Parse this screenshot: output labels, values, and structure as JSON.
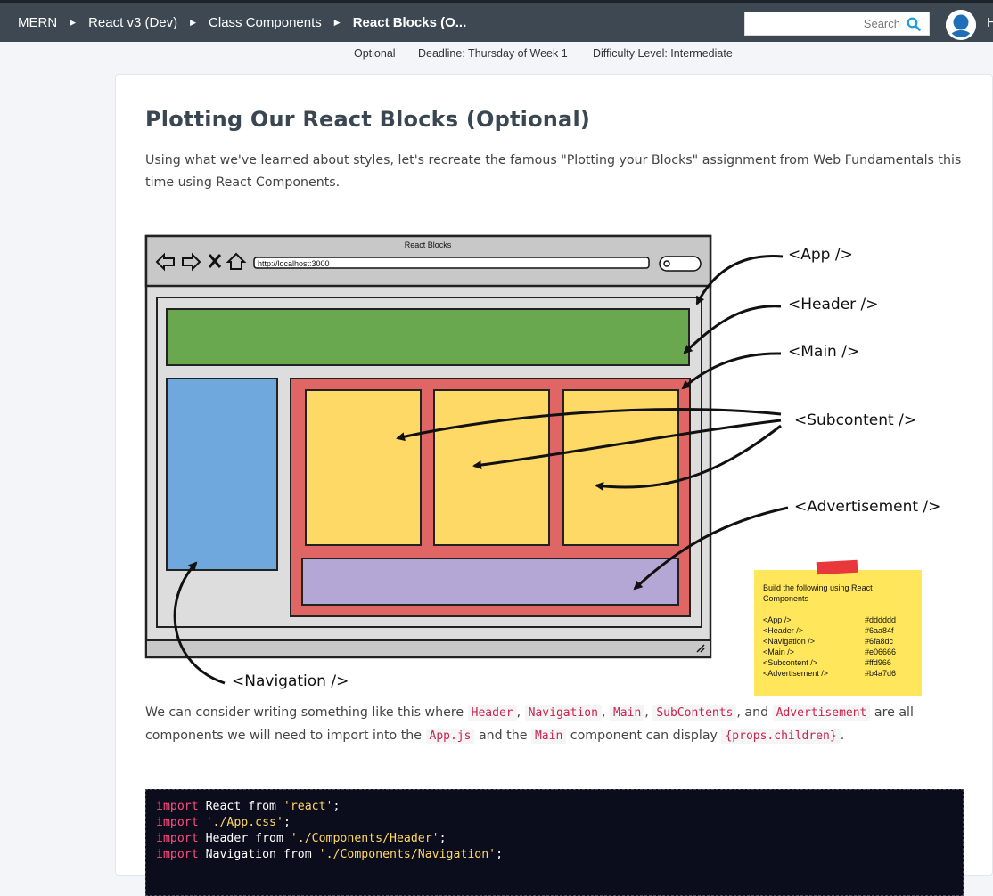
{
  "breadcrumb": [
    "MERN",
    "React v3 (Dev)",
    "Class Components",
    "React Blocks (O..."
  ],
  "search": {
    "placeholder": "Search"
  },
  "user_initial": "H",
  "meta": {
    "optional": "Optional",
    "deadline": "Deadline: Thursday of Week 1",
    "difficulty": "Difficulty Level: Intermediate"
  },
  "title": "Plotting Our React Blocks (Optional)",
  "intro": {
    "line1": "Using what we've learned about styles, let's recreate the famous \"Plotting your Blocks\" assignment from Web Fundamentals this",
    "line2": "time using React Components."
  },
  "diagram": {
    "window_title": "React Blocks",
    "url": "http://localhost:3000",
    "labels": {
      "app": "<App />",
      "header": "<Header />",
      "main": "<Main />",
      "subcontent": "<Subcontent />",
      "advertisement": "<Advertisement />",
      "navigation": "<Navigation />"
    },
    "note": {
      "title_line1": "Build the following using React",
      "title_line2": "Components",
      "rows": [
        {
          "component": "<App />",
          "color": "#dddddd"
        },
        {
          "component": "<Header />",
          "color": "#6aa84f"
        },
        {
          "component": "<Navigation />",
          "color": "#6fa8dc"
        },
        {
          "component": "<Main />",
          "color": "#e06666"
        },
        {
          "component": "<Subcontent />",
          "color": "#ffd966"
        },
        {
          "component": "<Advertisement />",
          "color": "#b4a7d6"
        }
      ]
    },
    "fills": {
      "app": "#dddddd",
      "header": "#6aa84f",
      "navigation": "#6fa8dc",
      "main": "#e06666",
      "subcontent": "#ffd966",
      "advertisement": "#b4a7d6"
    }
  },
  "paragraph2": {
    "t1": "We can consider writing something like this where ",
    "c_header": "Header",
    "comma1": ", ",
    "c_navigation": "Navigation",
    "comma2": ", ",
    "c_main": "Main",
    "comma3": ", ",
    "c_subcontents": "SubContents",
    "and": ", and ",
    "c_advertisement": "Advertisement",
    "t2": " are all",
    "t3": "components we will need to import into the ",
    "c_appjs": "App.js",
    "t4": " and the ",
    "c_main2": "Main",
    "t5": " component can display ",
    "c_props": "{props.children}",
    "t6": "."
  },
  "code": [
    {
      "kw": "import",
      "mid": " React from ",
      "str": "'react'",
      "end": ";"
    },
    {
      "kw": "import",
      "mid": " ",
      "str": "'./App.css'",
      "end": ";"
    },
    {
      "kw": "import",
      "mid": " Header from ",
      "str": "'./Components/Header'",
      "end": ";"
    },
    {
      "kw": "import",
      "mid": " Navigation from ",
      "str": "'./Components/Navigation'",
      "end": ";"
    }
  ],
  "colors": {
    "nav_bg": "#3d4852",
    "accent": "#1a9be0",
    "code_bg": "#0b0d1d"
  }
}
